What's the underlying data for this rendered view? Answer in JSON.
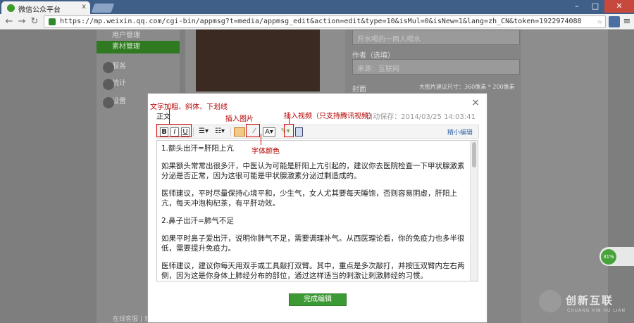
{
  "browser": {
    "tab_title": "微信公众平台",
    "tab_close": "x",
    "url": "https://mp.weixin.qq.com/cgi-bin/appmsg?t=media/appmsg_edit&action=edit&type=10&isMul=0&isNew=1&lang=zh_CN&token=1922974088"
  },
  "sidebar": {
    "items": [
      {
        "label": "用户管理"
      },
      {
        "label": "素材管理"
      },
      {
        "label": "服务"
      },
      {
        "label": "统计"
      },
      {
        "label": "设置"
      }
    ]
  },
  "right_panel": {
    "title_placeholder": "开水喝的一两人喝水",
    "author_label": "作者（选填）",
    "author_value": "来源：互联网",
    "cover_label": "封面",
    "cover_hint": "大图片建议尺寸：360像素 * 200像素"
  },
  "footer": {
    "left_text": "在线客服 | 意"
  },
  "modal": {
    "close": "×",
    "subtitle": "正文",
    "autosave": "自动保存：2014/03/25 14:03:41",
    "toolbar": {
      "bold": "B",
      "italic": "I",
      "underline": "U",
      "compact_link": "精小编辑"
    },
    "content": [
      "1.额头出汗=肝阳上亢",
      "如果额头常常出很多汗，中医认为可能是肝阳上亢引起的，建议你去医院检查一下甲状腺激素分泌是否正常，因为这很可能是甲状腺激素分泌过剩造成的。",
      "医师建议，平时尽量保持心境平和，少生气，女人尤其要每天睡饱，否则容易阴虚，肝阳上亢，每天冲泡枸杞茶，有平肝功效。",
      "2.鼻子出汗=肺气不足",
      "如果平时鼻子爱出汗，说明你肺气不足，需要调理补气。从西医理论看，你的免疫力也多半很低，需要提升免疫力。",
      "医师建议，建议你每天用双手或工具敲打双臂。其中，重点是多次敲打，并按压双臂内左右两侧，因为这是你身体上肺经分布的部位，通过这样适当的刺激让刺激肺经的习惯。"
    ],
    "done_button": "完成编辑"
  },
  "annotations": {
    "text_format": "文字加粗、斜体、下划线",
    "insert_image": "插入图片",
    "insert_video": "插入视频（只支持腾讯视频）",
    "font_color": "字体颜色"
  },
  "float_widget": {
    "percent": "31%"
  },
  "brand": {
    "name": "创新互联",
    "sub": "CHUANG XIN HU LIAN"
  },
  "colors": {
    "accent": "#3c9a34",
    "annotation": "#d40000"
  }
}
